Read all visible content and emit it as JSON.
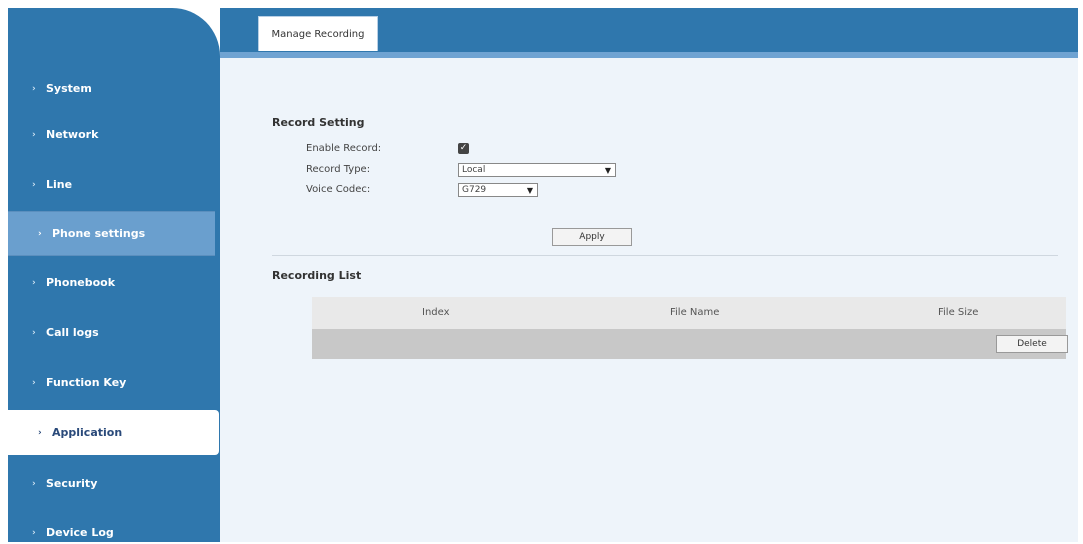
{
  "sidebar": {
    "items": [
      {
        "label": "System"
      },
      {
        "label": "Network"
      },
      {
        "label": "Line"
      },
      {
        "label": "Phone settings"
      },
      {
        "label": "Phonebook"
      },
      {
        "label": "Call logs"
      },
      {
        "label": "Function Key"
      },
      {
        "label": "Application"
      },
      {
        "label": "Security"
      },
      {
        "label": "Device Log"
      }
    ],
    "bullet_icon": "›"
  },
  "tabs": [
    {
      "label": "Manage Recording"
    }
  ],
  "record_setting": {
    "title": "Record Setting",
    "enable_record_label": "Enable Record:",
    "enable_record_checked": true,
    "record_type_label": "Record Type:",
    "record_type_value": "Local",
    "voice_codec_label": "Voice Codec:",
    "voice_codec_value": "G729",
    "apply_label": "Apply"
  },
  "recording_list": {
    "title": "Recording List",
    "columns": [
      "Index",
      "File Name",
      "File Size"
    ],
    "rows": [],
    "delete_label": "Delete"
  },
  "colors": {
    "sidebar": "#2f77ad",
    "highlight": "#6a9fce",
    "content_bg": "#eef4fa"
  }
}
